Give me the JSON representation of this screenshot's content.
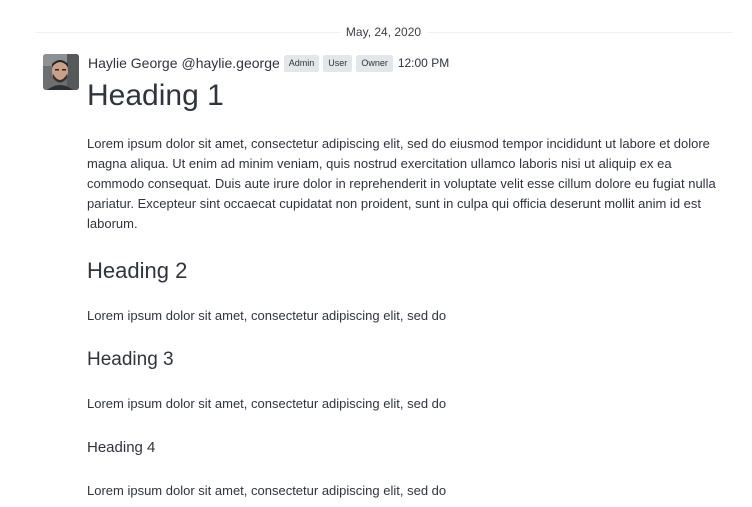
{
  "date_divider": "May, 24, 2020",
  "message": {
    "author_name": "Haylie George",
    "author_handle": "@haylie.george",
    "roles": [
      "Admin",
      "User",
      "Owner"
    ],
    "time": "12:00 PM",
    "avatar_icon": "user-avatar-photo",
    "heading1": "Heading 1",
    "paragraph1": "Lorem ipsum dolor sit amet, consectetur adipiscing elit, sed do eiusmod tempor incididunt ut labore et dolore magna aliqua. Ut enim ad minim veniam, quis nostrud exercitation ullamco laboris nisi ut aliquip ex ea commodo consequat. Duis aute irure dolor in reprehenderit in voluptate velit esse cillum dolore eu fugiat nulla pariatur. Excepteur sint occaecat cupidatat non proident, sunt in culpa qui officia deserunt mollit anim id est laborum.",
    "heading2": "Heading 2",
    "paragraph2": "Lorem ipsum dolor sit amet, consectetur adipiscing elit, sed do",
    "heading3": "Heading 3",
    "paragraph3": "Lorem ipsum dolor sit amet, consectetur adipiscing elit, sed do",
    "heading4": "Heading 4",
    "paragraph4": "Lorem ipsum dolor sit amet, consectetur adipiscing elit, sed do"
  },
  "colors": {
    "text": "#2f343d",
    "badge_bg": "#e4e7ea",
    "divider": "#eef0f2"
  }
}
